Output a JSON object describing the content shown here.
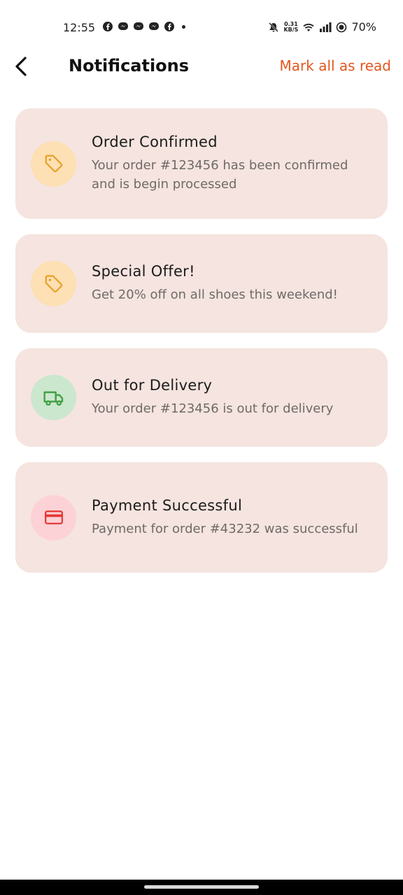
{
  "status_bar": {
    "time": "12:55",
    "speed_value": "0.31",
    "speed_unit": "KB/S",
    "battery": "70%"
  },
  "header": {
    "title": "Notifications",
    "mark_all_label": "Mark all as read"
  },
  "colors": {
    "accent": "#e2561e",
    "card_bg": "#f5e4df",
    "tag_circle": "#fde0b3",
    "tag_icon": "#e8a027",
    "truck_circle": "#cbe7cd",
    "truck_icon": "#43a047",
    "card_circle": "#fcd2d6",
    "card_icon": "#e53935"
  },
  "notifications": [
    {
      "icon": "tag-icon",
      "title": "Order Confirmed",
      "message": "Your order #123456 has been confirmed and is begin processed"
    },
    {
      "icon": "tag-icon",
      "title": "Special Offer!",
      "message": "Get 20% off on all shoes this weekend!"
    },
    {
      "icon": "truck-icon",
      "title": "Out for Delivery",
      "message": "Your order #123456 is out for delivery"
    },
    {
      "icon": "credit-card-icon",
      "title": "Payment Successful",
      "message": "Payment for order #43232 was successful"
    }
  ]
}
